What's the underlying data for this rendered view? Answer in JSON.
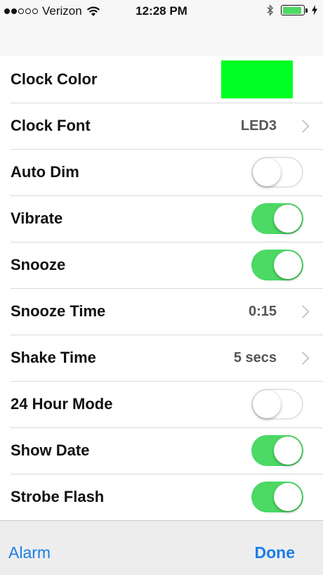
{
  "status_bar": {
    "signal_dots": [
      "filled",
      "filled",
      "empty",
      "empty",
      "empty"
    ],
    "carrier": "Verizon",
    "time": "12:28 PM",
    "battery_level": 0.9,
    "battery_color": "#4cd964",
    "icons": [
      "wifi-icon",
      "bluetooth-icon",
      "battery-icon",
      "charging-icon"
    ]
  },
  "settings": {
    "clock_color": {
      "label": "Clock Color",
      "color": "#00ff22"
    },
    "clock_font": {
      "label": "Clock Font",
      "value": "LED3"
    },
    "auto_dim": {
      "label": "Auto Dim",
      "on": false
    },
    "vibrate": {
      "label": "Vibrate",
      "on": true
    },
    "snooze": {
      "label": "Snooze",
      "on": true
    },
    "snooze_time": {
      "label": "Snooze Time",
      "value": "0:15"
    },
    "shake_time": {
      "label": "Shake Time",
      "value": "5 secs"
    },
    "hour_mode_24": {
      "label": "24 Hour Mode",
      "on": false
    },
    "show_date": {
      "label": "Show Date",
      "on": true
    },
    "strobe_flash": {
      "label": "Strobe Flash",
      "on": true
    },
    "toggle_on_color": "#4cd964",
    "chevron_icon": "chevron-right-icon"
  },
  "toolbar": {
    "alarm_label": "Alarm",
    "done_label": "Done",
    "accent_color": "#1a7ee6"
  }
}
